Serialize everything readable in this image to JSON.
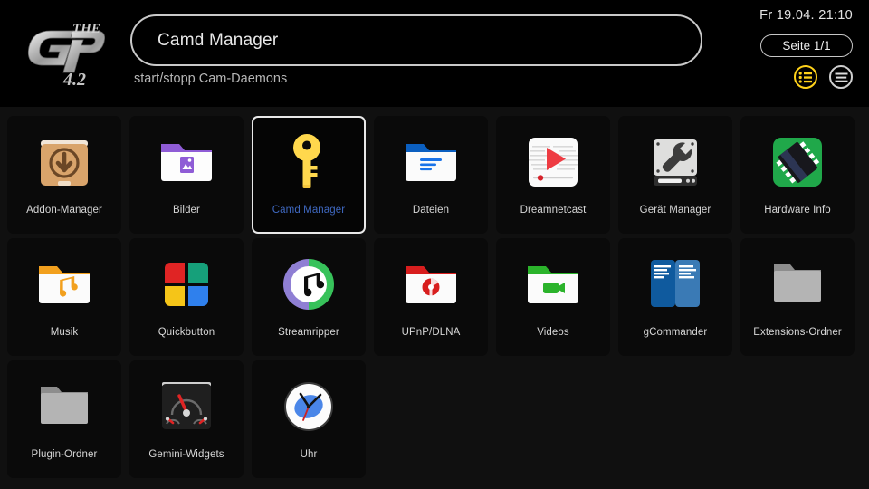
{
  "header": {
    "logo_alt": "The GP 4.2",
    "logo_text_top": "THE",
    "logo_text_main": "GP",
    "logo_text_bottom": "4.2",
    "search_value": "Camd Manager",
    "search_placeholder": "Camd Manager",
    "subtitle": "start/stopp Cam-Daemons",
    "datetime": "Fr 19.04.  21:10",
    "page_label": "Seite 1/1",
    "icons": [
      {
        "name": "list-view-icon",
        "color": "#ffd21a",
        "active": true
      },
      {
        "name": "menu-icon",
        "color": "#cfcfcf",
        "active": false
      }
    ]
  },
  "grid": {
    "columns": 7,
    "tiles": [
      {
        "label": "Addon-Manager",
        "icon": "addon-manager-icon",
        "selected": false
      },
      {
        "label": "Bilder",
        "icon": "pictures-folder-icon",
        "selected": false
      },
      {
        "label": "Camd Manager",
        "icon": "key-icon",
        "selected": true
      },
      {
        "label": "Dateien",
        "icon": "files-folder-icon",
        "selected": false
      },
      {
        "label": "Dreamnetcast",
        "icon": "media-play-icon",
        "selected": false
      },
      {
        "label": "Gerät Manager",
        "icon": "device-wrench-icon",
        "selected": false
      },
      {
        "label": "Hardware Info",
        "icon": "chip-icon",
        "selected": false
      },
      {
        "label": "Musik",
        "icon": "music-folder-icon",
        "selected": false
      },
      {
        "label": "Quickbutton",
        "icon": "four-squares-icon",
        "selected": false
      },
      {
        "label": "Streamripper",
        "icon": "music-ring-icon",
        "selected": false
      },
      {
        "label": "UPnP/DLNA",
        "icon": "network-folder-icon",
        "selected": false
      },
      {
        "label": "Videos",
        "icon": "video-folder-icon",
        "selected": false
      },
      {
        "label": "gCommander",
        "icon": "dual-pane-icon",
        "selected": false
      },
      {
        "label": "Extensions-Ordner",
        "icon": "grey-folder-icon",
        "selected": false
      },
      {
        "label": "Plugin-Ordner",
        "icon": "grey-folder-icon",
        "selected": false
      },
      {
        "label": "Gemini-Widgets",
        "icon": "gauges-icon",
        "selected": false
      },
      {
        "label": "Uhr",
        "icon": "clock-icon",
        "selected": false
      }
    ]
  },
  "colors": {
    "background": "#101010",
    "header_bg": "#000000",
    "tile_bg": "#0a0a0a",
    "selected_border": "#e9e9e9",
    "selected_label": "#3f68c0",
    "label": "#d6d6d6",
    "accent_yellow": "#ffd21a"
  }
}
